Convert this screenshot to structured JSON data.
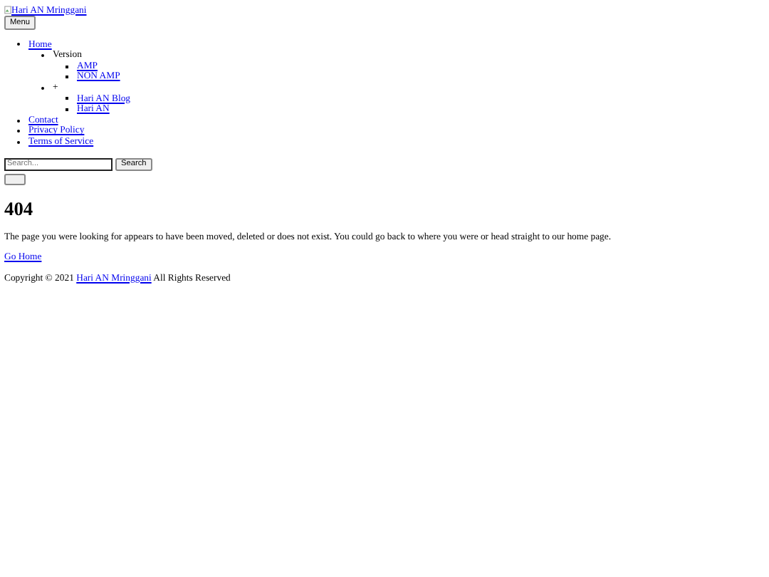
{
  "logo": {
    "alt": "Hari AN Mringgani"
  },
  "menu_button": "Menu",
  "nav": [
    {
      "label": "Home",
      "kind": "link",
      "children": [
        {
          "label": "Version",
          "kind": "text",
          "children": [
            {
              "label": "AMP",
              "kind": "link"
            },
            {
              "label": "NON AMP",
              "kind": "link"
            }
          ]
        },
        {
          "label": "+",
          "kind": "text",
          "children": [
            {
              "label": "Hari AN Blog",
              "kind": "link"
            },
            {
              "label": "Hari AN",
              "kind": "link"
            }
          ]
        }
      ]
    },
    {
      "label": "Contact",
      "kind": "link"
    },
    {
      "label": "Privacy Policy",
      "kind": "link"
    },
    {
      "label": "Terms of Service",
      "kind": "link"
    }
  ],
  "search": {
    "placeholder": "Search...",
    "button": "Search"
  },
  "heading": "404",
  "message": "The page you were looking for appears to have been moved, deleted or does not exist. You could go back to where you were or head straight to our home page.",
  "home_link": "Go Home",
  "footer": {
    "prefix": "Copyright © 2021",
    "link": "Hari AN Mringgani",
    "suffix": "All Rights Reserved"
  }
}
